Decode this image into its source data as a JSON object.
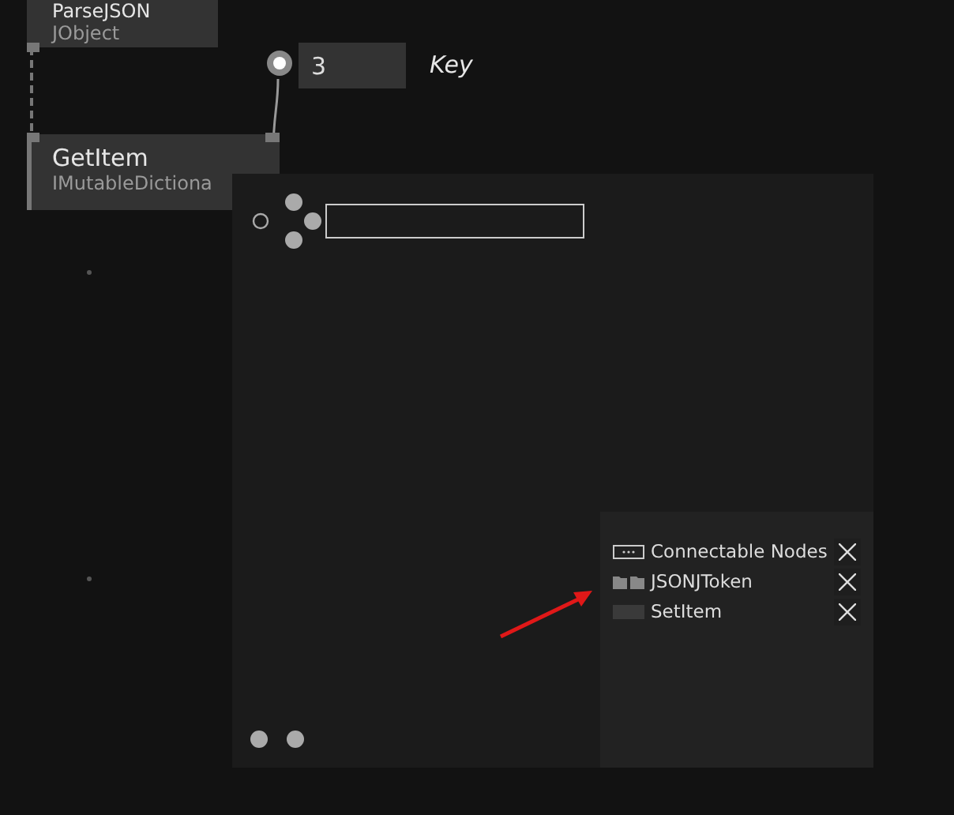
{
  "nodes": [
    {
      "title": "ParseJSON",
      "type": "JObject"
    },
    {
      "title": "GetItem",
      "type": "IMutableDictiona"
    }
  ],
  "pin_input": {
    "value": "3",
    "label": "Key"
  },
  "results": [
    {
      "label": "Connectable Nodes",
      "kind": "category"
    },
    {
      "label": "JSONJToken",
      "kind": "folder"
    },
    {
      "label": "SetItem",
      "kind": "node"
    }
  ]
}
